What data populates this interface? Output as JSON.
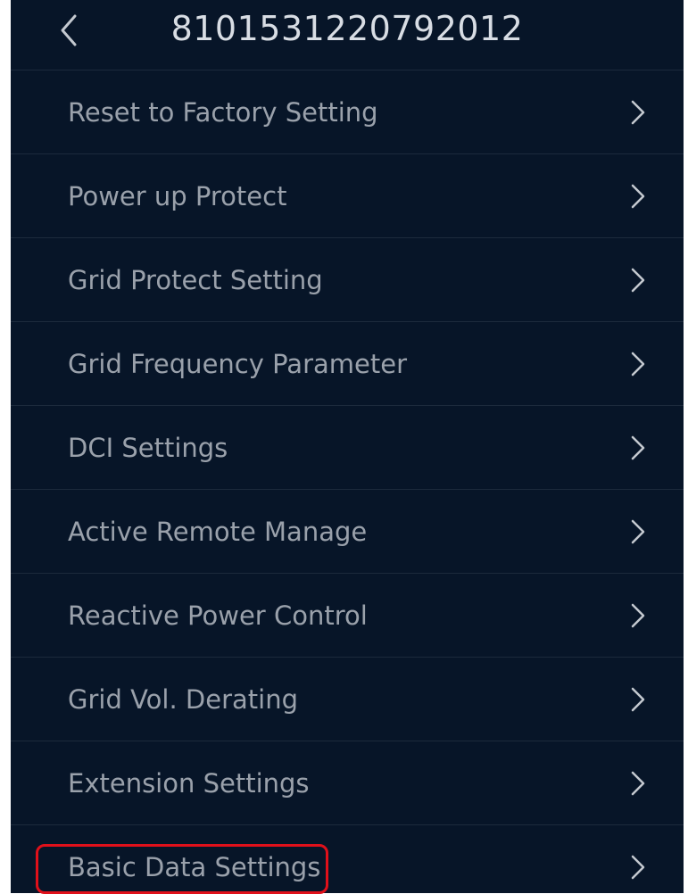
{
  "header": {
    "title": "8101531220792012",
    "back_icon": "chevron-left-icon"
  },
  "menu": {
    "items": [
      {
        "label": "Reset to Factory Setting",
        "icon": "chevron-right-icon"
      },
      {
        "label": "Power up Protect",
        "icon": "chevron-right-icon"
      },
      {
        "label": "Grid Protect Setting",
        "icon": "chevron-right-icon"
      },
      {
        "label": "Grid Frequency Parameter",
        "icon": "chevron-right-icon"
      },
      {
        "label": "DCI Settings",
        "icon": "chevron-right-icon"
      },
      {
        "label": "Active Remote Manage",
        "icon": "chevron-right-icon"
      },
      {
        "label": "Reactive Power Control",
        "icon": "chevron-right-icon"
      },
      {
        "label": "Grid Vol. Derating",
        "icon": "chevron-right-icon"
      },
      {
        "label": "Extension Settings",
        "icon": "chevron-right-icon"
      },
      {
        "label": "Basic Data Settings",
        "icon": "chevron-right-icon"
      }
    ]
  },
  "highlight": {
    "target": "Basic Data Settings",
    "color": "#e0101a"
  },
  "colors": {
    "background": "#071528",
    "divider": "#1c2a3c",
    "title_text": "#d8dde4",
    "item_text": "#9aa1ab",
    "chevron": "#c4c9d0"
  }
}
